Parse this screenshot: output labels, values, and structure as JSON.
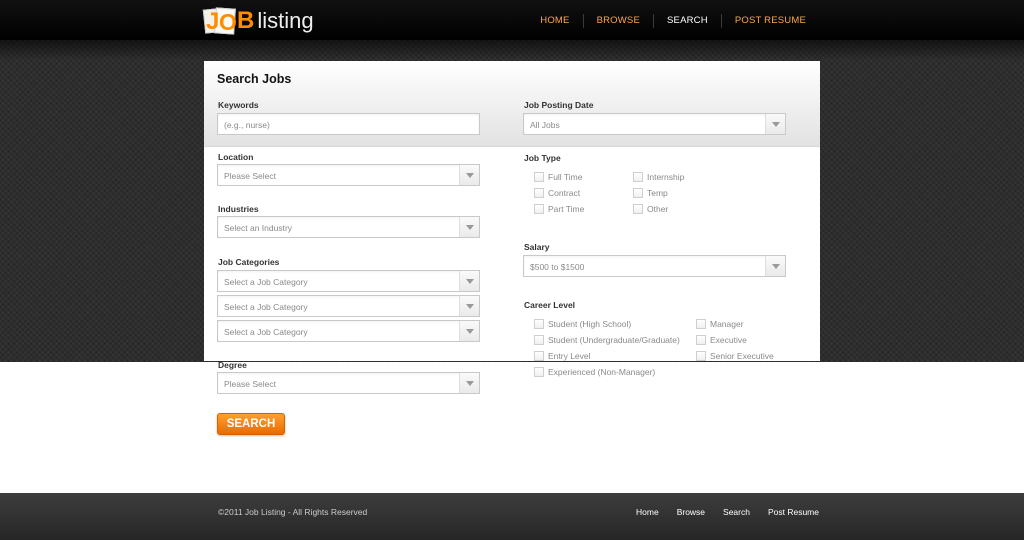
{
  "logo": {
    "j": "J",
    "o": "O",
    "b": "B",
    "word": "listing"
  },
  "nav": [
    {
      "label": "HOME"
    },
    {
      "label": "BROWSE"
    },
    {
      "label": "SEARCH",
      "active": true
    },
    {
      "label": "POST RESUME"
    }
  ],
  "form": {
    "title": "Search Jobs",
    "keywords": {
      "label": "Keywords",
      "placeholder": "(e.g., nurse)"
    },
    "posting_date": {
      "label": "Job Posting Date",
      "value": "All Jobs"
    },
    "location": {
      "label": "Location",
      "value": "Please Select"
    },
    "job_type": {
      "label": "Job Type",
      "options": [
        "Full Time",
        "Contract",
        "Part Time",
        "Internship",
        "Temp",
        "Other"
      ]
    },
    "industries": {
      "label": "Industries",
      "value": "Select an Industry"
    },
    "salary": {
      "label": "Salary",
      "value": "$500 to $1500"
    },
    "job_categories": {
      "label": "Job Categories",
      "values": [
        "Select a Job Category",
        "Select a Job Category",
        "Select a Job Category"
      ]
    },
    "career_level": {
      "label": "Career Level",
      "options": [
        "Student (High School)",
        "Student (Undergraduate/Graduate)",
        "Entry Level",
        "Experienced (Non-Manager)",
        "Manager",
        "Executive",
        "Senior Executive"
      ]
    },
    "degree": {
      "label": "Degree",
      "value": "Please Select"
    },
    "search_label": "SEARCH"
  },
  "footer": {
    "copyright": "©2011 Job Listing - All Rights Reserved",
    "links": [
      "Home",
      "Browse",
      "Search",
      "Post Resume"
    ]
  },
  "colors": {
    "accent": "#ff8c00",
    "nav_link": "#ffa54a",
    "header_bg": "#000000",
    "band_bg": "#2b2b2b"
  }
}
